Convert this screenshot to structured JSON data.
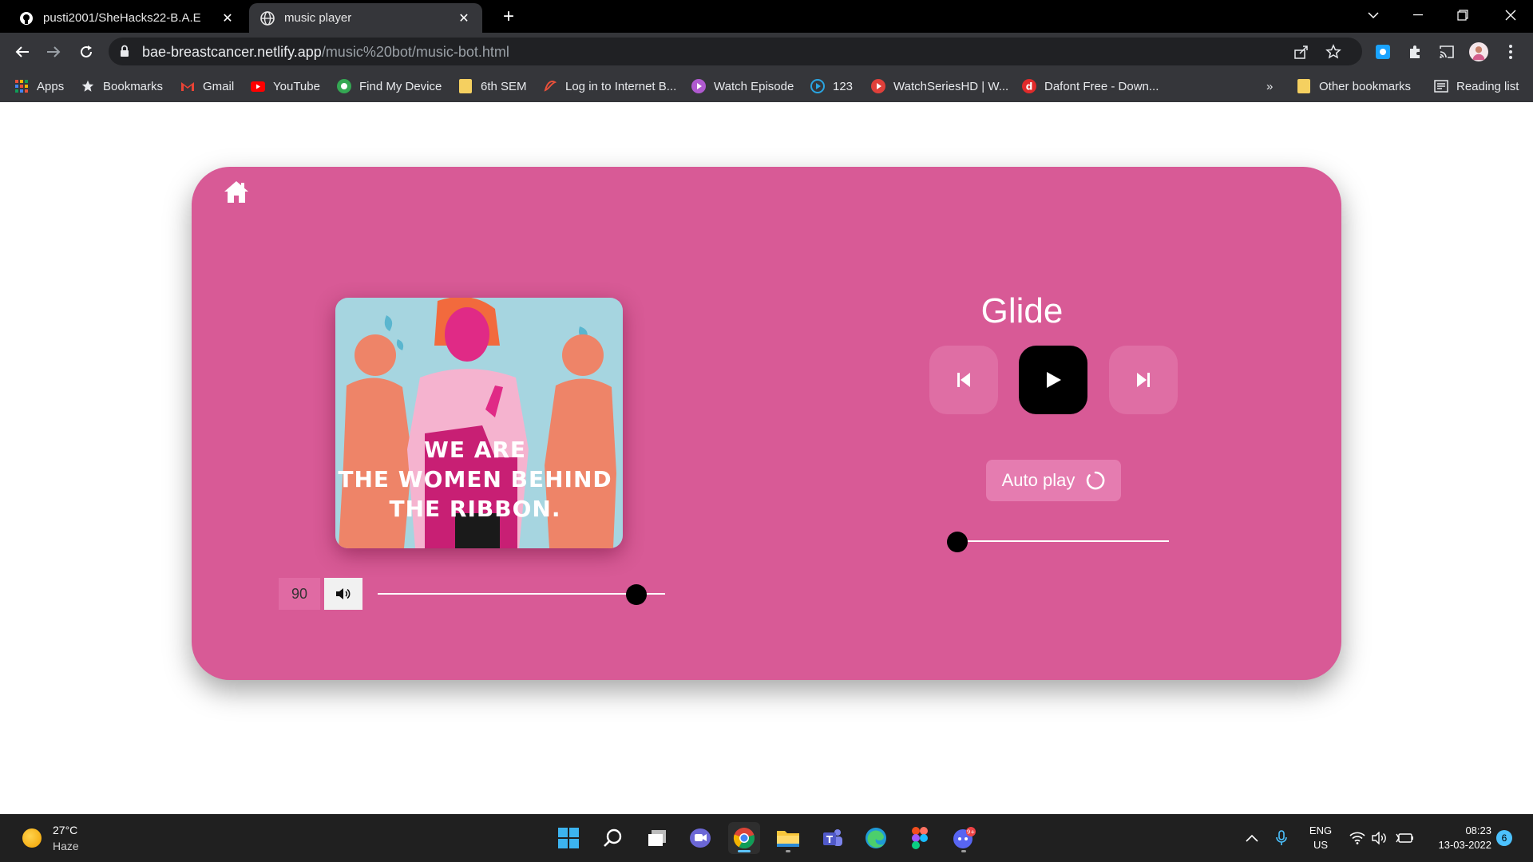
{
  "browser": {
    "tabs": [
      {
        "title": "pusti2001/SheHacks22-B.A.E",
        "active": false,
        "icon": "github-icon"
      },
      {
        "title": "music player",
        "active": true,
        "icon": "globe-icon"
      }
    ],
    "url_host": "bae-breastcancer.netlify.app",
    "url_path": "/music%20bot/music-bot.html",
    "bookmarks": [
      {
        "label": "Apps",
        "icon": "apps-grid-icon"
      },
      {
        "label": "Bookmarks",
        "icon": "star-icon"
      },
      {
        "label": "Gmail",
        "icon": "gmail-icon"
      },
      {
        "label": "YouTube",
        "icon": "youtube-icon"
      },
      {
        "label": "Find My Device",
        "icon": "find-device-icon"
      },
      {
        "label": "6th SEM",
        "icon": "folder-icon"
      },
      {
        "label": "Log in to Internet B...",
        "icon": "bank-icon"
      },
      {
        "label": "Watch Episode",
        "icon": "play-circle-icon"
      },
      {
        "label": "123",
        "icon": "play-circle-icon"
      },
      {
        "label": "WatchSeriesHD | W...",
        "icon": "play-circle-icon"
      },
      {
        "label": "Dafont Free - Down...",
        "icon": "dafont-icon"
      }
    ],
    "overflow": "»",
    "other_bookmarks": "Other bookmarks",
    "reading_list": "Reading list"
  },
  "player": {
    "cover_text": [
      "WE ARE",
      "THE WOMEN BEHIND",
      "THE RIBBON."
    ],
    "volume_value": "90",
    "volume_level": 0.9,
    "song_title": "Glide",
    "autoplay_label": "Auto play",
    "seek_level": 0.0
  },
  "colors": {
    "card_bg": "#d85a96",
    "button_bg": "#df6ea4",
    "play_bg": "#000000"
  },
  "taskbar": {
    "temperature": "27°C",
    "condition": "Haze",
    "language": "ENG",
    "region": "US",
    "time": "08:23",
    "date": "13-03-2022",
    "notification_count": "6",
    "discord_badge": "9+"
  }
}
